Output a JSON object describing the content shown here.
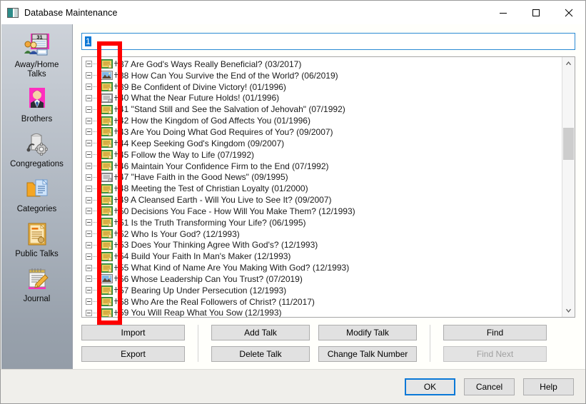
{
  "window": {
    "title": "Database Maintenance",
    "icon": "app-window-icon",
    "minimize_label": "—",
    "maximize_label": "□",
    "close_label": "✕"
  },
  "sidebar": {
    "items": [
      {
        "label": "Away/Home\nTalks",
        "label_line1": "Away/Home",
        "label_line2": "Talks",
        "icon": "calendar-people-icon"
      },
      {
        "label": "Brothers",
        "label_line1": "Brothers",
        "label_line2": "",
        "icon": "person-suit-icon"
      },
      {
        "label": "Congregations",
        "label_line1": "Congregations",
        "label_line2": "",
        "icon": "building-gear-icon"
      },
      {
        "label": "Categories",
        "label_line1": "Categories",
        "label_line2": "",
        "icon": "folder-document-icon"
      },
      {
        "label": "Public Talks",
        "label_line1": "Public Talks",
        "label_line2": "",
        "icon": "certificate-document-icon"
      },
      {
        "label": "Journal",
        "label_line1": "Journal",
        "label_line2": "",
        "icon": "notepad-pencil-icon"
      }
    ]
  },
  "search": {
    "value": "1",
    "placeholder": "",
    "selected": true
  },
  "talk_list": {
    "items": [
      {
        "number": "37",
        "title": "Are God's Ways Really Beneficial?",
        "date": "(03/2017)",
        "icon": "document-yellow-icon"
      },
      {
        "number": "38",
        "title": "How Can You Survive the End of the World?",
        "date": "(06/2019)",
        "icon": "image-blue-icon"
      },
      {
        "number": "39",
        "title": "Be Confident of Divine Victory!",
        "date": "(01/1996)",
        "icon": "document-yellow-icon"
      },
      {
        "number": "40",
        "title": "What the Near Future Holds!",
        "date": "(01/1996)",
        "icon": "document-gray-icon"
      },
      {
        "number": "41",
        "title": "\"Stand Still and See the Salvation of Jehovah\"",
        "date": "(07/1992)",
        "icon": "document-yellow-icon"
      },
      {
        "number": "42",
        "title": "How the Kingdom of God Affects You",
        "date": "(01/1996)",
        "icon": "document-yellow-icon"
      },
      {
        "number": "43",
        "title": "Are You Doing What God Requires of You?",
        "date": "(09/2007)",
        "icon": "document-yellow-icon"
      },
      {
        "number": "44",
        "title": "Keep Seeking God's Kingdom",
        "date": "(09/2007)",
        "icon": "document-yellow-icon"
      },
      {
        "number": "45",
        "title": "Follow the Way to Life",
        "date": "(07/1992)",
        "icon": "document-yellow-icon"
      },
      {
        "number": "46",
        "title": "Maintain Your Confidence Firm to the End",
        "date": "(07/1992)",
        "icon": "document-yellow-icon"
      },
      {
        "number": "47",
        "title": "\"Have Faith in the Good News\"",
        "date": "(09/1995)",
        "icon": "document-gray-icon"
      },
      {
        "number": "48",
        "title": "Meeting the Test of Christian Loyalty",
        "date": "(01/2000)",
        "icon": "document-yellow-icon"
      },
      {
        "number": "49",
        "title": "A Cleansed Earth - Will You Live to See It?",
        "date": "(09/2007)",
        "icon": "document-yellow-icon"
      },
      {
        "number": "50",
        "title": "Decisions You Face - How Will You Make Them?",
        "date": "(12/1993)",
        "icon": "document-yellow-icon"
      },
      {
        "number": "51",
        "title": "Is the Truth Transforming Your Life?",
        "date": "(06/1995)",
        "icon": "document-yellow-icon"
      },
      {
        "number": "52",
        "title": "Who Is Your God?",
        "date": "(12/1993)",
        "icon": "document-yellow-icon"
      },
      {
        "number": "53",
        "title": "Does Your Thinking Agree With God's?",
        "date": "(12/1993)",
        "icon": "document-yellow-icon"
      },
      {
        "number": "54",
        "title": "Build Your Faith In Man's Maker",
        "date": "(12/1993)",
        "icon": "document-yellow-icon"
      },
      {
        "number": "55",
        "title": "What Kind of Name Are You Making With God?",
        "date": "(12/1993)",
        "icon": "document-yellow-icon"
      },
      {
        "number": "56",
        "title": "Whose Leadership Can You Trust?",
        "date": "(07/2019)",
        "icon": "image-blue-icon"
      },
      {
        "number": "57",
        "title": "Bearing Up Under Persecution",
        "date": "(12/1993)",
        "icon": "document-yellow-icon"
      },
      {
        "number": "58",
        "title": "Who Are the Real Followers of Christ?",
        "date": "(11/2017)",
        "icon": "document-yellow-icon"
      },
      {
        "number": "59",
        "title": "You Will Reap What You Sow",
        "date": "(12/1993)",
        "icon": "document-yellow-icon"
      }
    ]
  },
  "actions": {
    "import": "Import",
    "export": "Export",
    "add_talk": "Add Talk",
    "modify_talk": "Modify Talk",
    "delete_talk": "Delete Talk",
    "change_talk_number": "Change Talk Number",
    "find": "Find",
    "find_next": "Find Next",
    "find_next_disabled": true
  },
  "footer": {
    "ok": "OK",
    "cancel": "Cancel",
    "help": "Help"
  },
  "colors": {
    "accent": "#0a78d7",
    "annotation": "#fe0000",
    "sidebar_top": "#cdd2d9",
    "sidebar_bottom": "#949da8",
    "panel_bg": "#fffffb",
    "button_face": "#e1e1e1"
  }
}
